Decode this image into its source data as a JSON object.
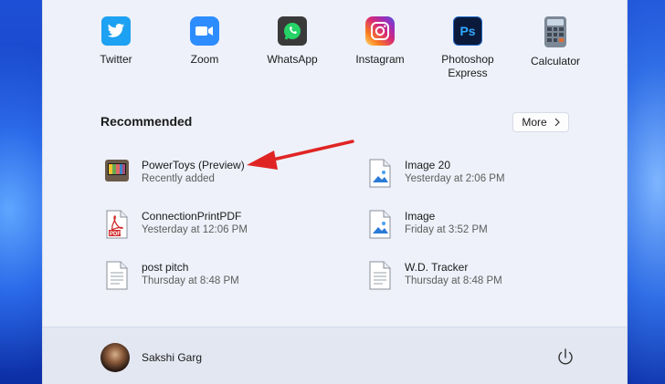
{
  "pinned_apps": [
    {
      "label": "Twitter",
      "icon": "twitter-icon",
      "color": "#1da1f2"
    },
    {
      "label": "Zoom",
      "icon": "zoom-icon",
      "color": "#2d8cff"
    },
    {
      "label": "WhatsApp",
      "icon": "whatsapp-icon",
      "color": "#3a3a3a"
    },
    {
      "label": "Instagram",
      "icon": "instagram-icon",
      "color": "#d6249f"
    },
    {
      "label": "Photoshop Express",
      "icon": "photoshop-express-icon",
      "color": "#0b1a3a"
    },
    {
      "label": "Calculator",
      "icon": "calculator-icon",
      "color": "#7d8896"
    }
  ],
  "recommended": {
    "title": "Recommended",
    "more_label": "More",
    "items": [
      {
        "name": "PowerToys (Preview)",
        "sub": "Recently added",
        "icon": "powertoys-icon"
      },
      {
        "name": "Image 20",
        "sub": "Yesterday at 2:06 PM",
        "icon": "image-file-icon"
      },
      {
        "name": "ConnectionPrintPDF",
        "sub": "Yesterday at 12:06 PM",
        "icon": "pdf-file-icon"
      },
      {
        "name": "Image",
        "sub": "Friday at 3:52 PM",
        "icon": "image-file-icon"
      },
      {
        "name": "post pitch",
        "sub": "Thursday at 8:48 PM",
        "icon": "document-file-icon"
      },
      {
        "name": "W.D. Tracker",
        "sub": "Thursday at 8:48 PM",
        "icon": "document-file-icon"
      }
    ]
  },
  "user": {
    "name": "Sakshi Garg"
  },
  "colors": {
    "annotation_arrow": "#e02424",
    "panel_bg": "#eef1f9"
  }
}
